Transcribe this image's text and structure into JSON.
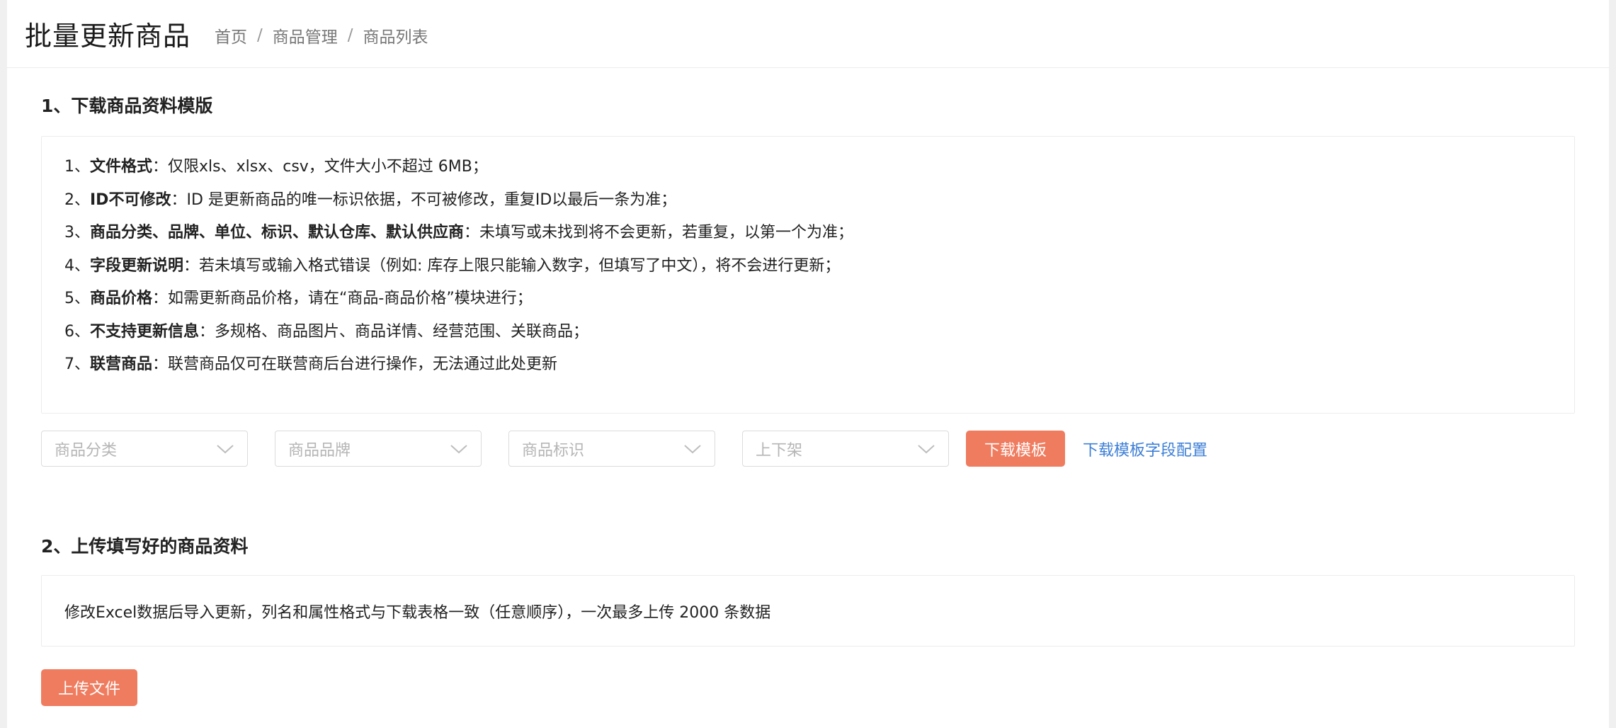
{
  "header": {
    "title": "批量更新商品",
    "breadcrumb": [
      "首页",
      "商品管理",
      "商品列表"
    ],
    "separator": "/"
  },
  "step1": {
    "title": "1、下载商品资料模版",
    "rules": [
      {
        "prefix": "1、",
        "label": "文件格式",
        "text": "：仅限xls、xlsx、csv，文件大小不超过 6MB；"
      },
      {
        "prefix": "2、",
        "label": "ID不可修改",
        "text": "：ID 是更新商品的唯一标识依据，不可被修改，重复ID以最后一条为准；"
      },
      {
        "prefix": "3、",
        "label": "商品分类、品牌、单位、标识、默认仓库、默认供应商",
        "text": "：未填写或未找到将不会更新，若重复，以第一个为准；"
      },
      {
        "prefix": "4、",
        "label": "字段更新说明",
        "text": "：若未填写或输入格式错误（例如: 库存上限只能输入数字，但填写了中文），将不会进行更新；"
      },
      {
        "prefix": "5、",
        "label": "商品价格",
        "text": "：如需更新商品价格，请在“商品-商品价格”模块进行；"
      },
      {
        "prefix": "6、",
        "label": "不支持更新信息",
        "text": "：多规格、商品图片、商品详情、经营范围、关联商品；"
      },
      {
        "prefix": "7、",
        "label": "联营商品",
        "text": "：联营商品仅可在联营商后台进行操作，无法通过此处更新"
      }
    ],
    "filters": {
      "category_placeholder": "商品分类",
      "brand_placeholder": "商品品牌",
      "tag_placeholder": "商品标识",
      "status_placeholder": "上下架"
    },
    "download_button": "下载模板",
    "config_link": "下载模板字段配置"
  },
  "step2": {
    "title": "2、上传填写好的商品资料",
    "note": "修改Excel数据后导入更新，列名和属性格式与下载表格一致（任意顺序），一次最多上传 2000 条数据",
    "upload_button": "上传文件"
  },
  "colors": {
    "primary": "#f07c5f",
    "link": "#3d7fd6",
    "placeholder": "#b5b5b5"
  }
}
